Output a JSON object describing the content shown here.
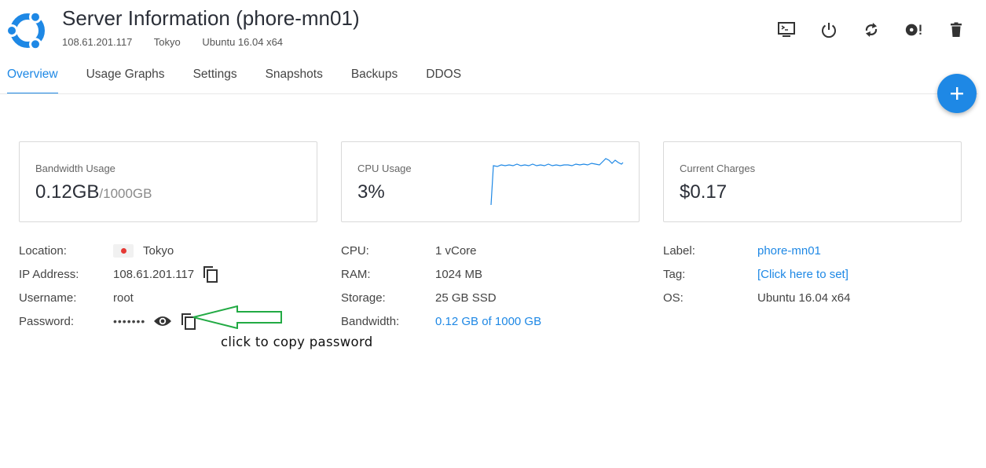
{
  "header": {
    "title": "Server Information (phore-mn01)",
    "ip": "108.61.201.117",
    "location": "Tokyo",
    "os": "Ubuntu 16.04 x64",
    "brand_color": "#1e88e5"
  },
  "toolbar": {
    "icons": [
      "console-icon",
      "power-icon",
      "restart-icon",
      "reinstall-icon",
      "delete-icon"
    ]
  },
  "tabs": [
    {
      "label": "Overview",
      "active": true
    },
    {
      "label": "Usage Graphs",
      "active": false
    },
    {
      "label": "Settings",
      "active": false
    },
    {
      "label": "Snapshots",
      "active": false
    },
    {
      "label": "Backups",
      "active": false
    },
    {
      "label": "DDOS",
      "active": false
    }
  ],
  "fab": {
    "icon": "plus-icon"
  },
  "cards": {
    "bandwidth": {
      "label": "Bandwidth Usage",
      "value": "0.12GB",
      "limit": "/1000GB"
    },
    "cpu": {
      "label": "CPU Usage",
      "value": "3%"
    },
    "charges": {
      "label": "Current Charges",
      "value": "$0.17"
    }
  },
  "details": {
    "location_label": "Location:",
    "location_value": "Tokyo",
    "ip_label": "IP Address:",
    "ip_value": "108.61.201.117",
    "username_label": "Username:",
    "username_value": "root",
    "password_label": "Password:",
    "password_value": "•••••••",
    "cpu_label": "CPU:",
    "cpu_value": "1 vCore",
    "ram_label": "RAM:",
    "ram_value": "1024 MB",
    "storage_label": "Storage:",
    "storage_value": "25 GB SSD",
    "bandwidth_label": "Bandwidth:",
    "bandwidth_value": "0.12 GB of 1000 GB",
    "label_label": "Label:",
    "label_value": "phore-mn01",
    "tag_label": "Tag:",
    "tag_value": "[Click here to set]",
    "os_label": "OS:",
    "os_value": "Ubuntu 16.04 x64"
  },
  "annotation": {
    "text": "click to copy password",
    "color": "#22aa44"
  }
}
